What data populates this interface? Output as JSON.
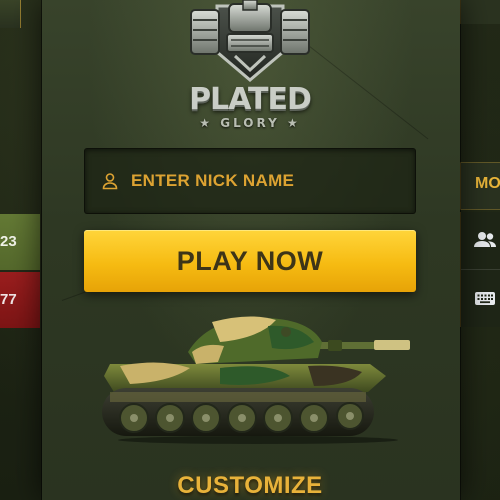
{
  "logo": {
    "title": "PLATED",
    "subtitle": "★ GLORY ★"
  },
  "nickname": {
    "placeholder": "ENTER NICK NAME",
    "value": "",
    "icon": "user-icon"
  },
  "play": {
    "label": "PLAY NOW"
  },
  "customize": {
    "label": "CUSTOMIZE"
  },
  "left_panel": {
    "green_score": "23",
    "red_score": "77"
  },
  "right_panel": {
    "mode_label": "MO",
    "icons": [
      "players-icon",
      "keyboard-icon"
    ]
  },
  "colors": {
    "accent": "#f6bb12",
    "accent_text": "#e2a935",
    "panel": "#2e3823",
    "team_green": "#5f7432",
    "team_red": "#8e1b1b"
  }
}
